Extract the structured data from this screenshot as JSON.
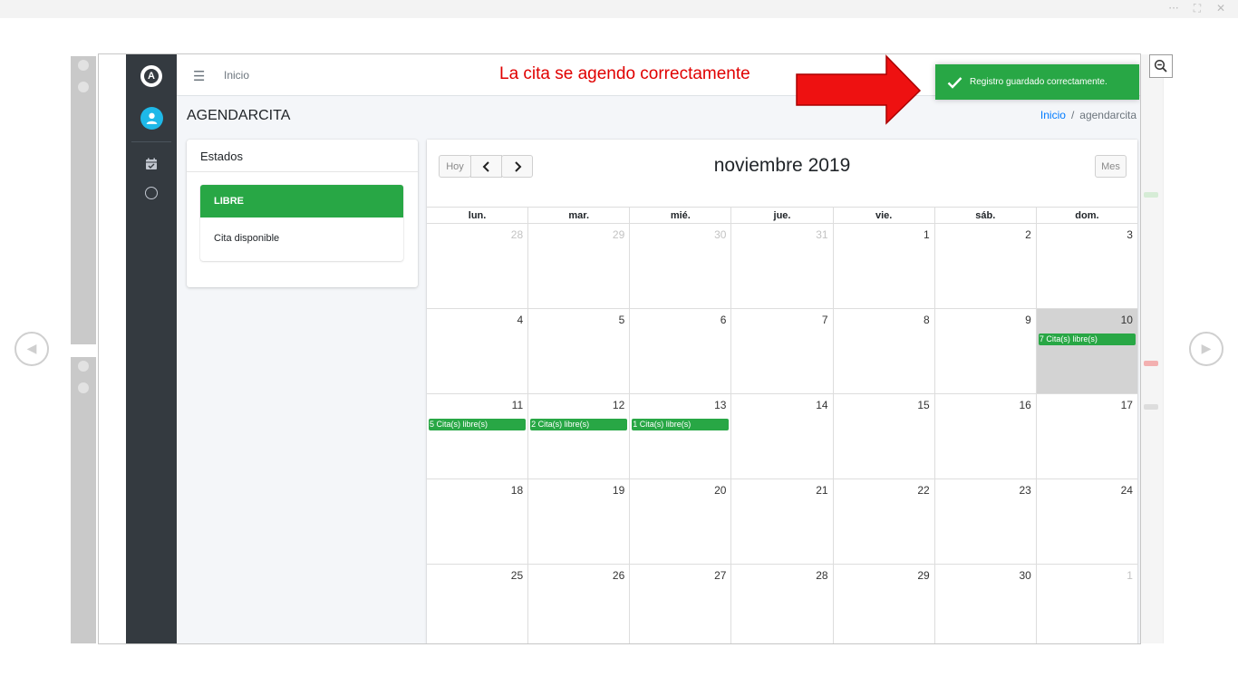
{
  "viewer": {
    "tools": [
      "···",
      "⛶",
      "✕"
    ]
  },
  "page": {
    "header_nav": "Inicio",
    "title": "AGENDARCITA",
    "breadcrumb": {
      "home": "Inicio",
      "separator": "/",
      "current": "agendarcita"
    }
  },
  "annotation": "La cita se agendo correctamente",
  "toast": {
    "message": "Registro guardado correctamente."
  },
  "estados": {
    "header": "Estados",
    "items": [
      {
        "label": "LIBRE",
        "description": "Cita disponible",
        "color": "#28a745"
      }
    ]
  },
  "calendar": {
    "today_label": "Hoy",
    "view_label": "Mes",
    "title": "noviembre 2019",
    "day_headers": [
      "lun.",
      "mar.",
      "mié.",
      "jue.",
      "vie.",
      "sáb.",
      "dom."
    ],
    "weeks": [
      [
        {
          "n": "28",
          "other": true
        },
        {
          "n": "29",
          "other": true
        },
        {
          "n": "30",
          "other": true
        },
        {
          "n": "31",
          "other": true
        },
        {
          "n": "1"
        },
        {
          "n": "2"
        },
        {
          "n": "3"
        }
      ],
      [
        {
          "n": "4"
        },
        {
          "n": "5"
        },
        {
          "n": "6"
        },
        {
          "n": "7"
        },
        {
          "n": "8"
        },
        {
          "n": "9"
        },
        {
          "n": "10",
          "today": true,
          "event": "7 Cita(s) libre(s)"
        }
      ],
      [
        {
          "n": "11",
          "event": "5 Cita(s) libre(s)"
        },
        {
          "n": "12",
          "event": "2 Cita(s) libre(s)"
        },
        {
          "n": "13",
          "event": "1 Cita(s) libre(s)"
        },
        {
          "n": "14"
        },
        {
          "n": "15"
        },
        {
          "n": "16"
        },
        {
          "n": "17"
        }
      ],
      [
        {
          "n": "18"
        },
        {
          "n": "19"
        },
        {
          "n": "20"
        },
        {
          "n": "21"
        },
        {
          "n": "22"
        },
        {
          "n": "23"
        },
        {
          "n": "24"
        }
      ],
      [
        {
          "n": "25"
        },
        {
          "n": "26"
        },
        {
          "n": "27"
        },
        {
          "n": "28"
        },
        {
          "n": "29"
        },
        {
          "n": "30"
        },
        {
          "n": "1",
          "other": true
        }
      ]
    ]
  },
  "colors": {
    "accent_green": "#28a745",
    "sidebar": "#343a40",
    "annotation_red": "#e00000"
  },
  "icons": {
    "prev": "chevron-left-icon",
    "next": "chevron-right-icon",
    "zoom": "zoom-out-icon",
    "check": "check-icon"
  }
}
